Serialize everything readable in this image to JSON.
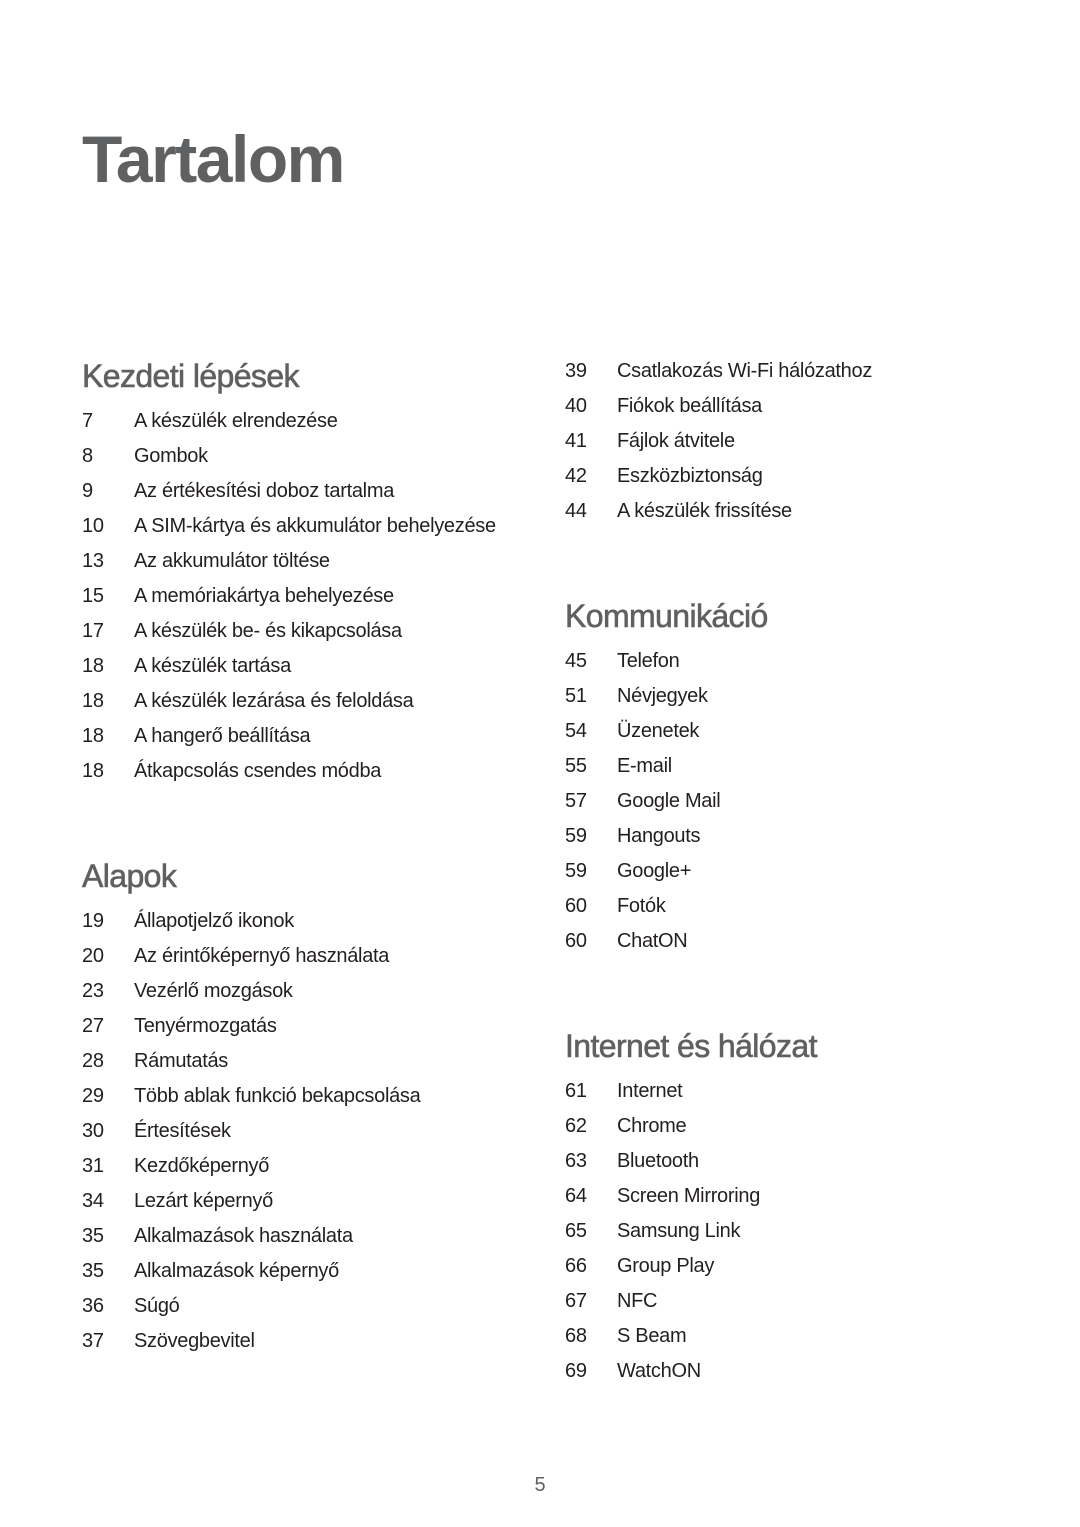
{
  "page": {
    "title": "Tartalom",
    "page_number": "5"
  },
  "sections": {
    "kezdeti": {
      "heading": "Kezdeti lépések",
      "items": [
        {
          "page": "7",
          "label": "A készülék elrendezése"
        },
        {
          "page": "8",
          "label": "Gombok"
        },
        {
          "page": "9",
          "label": "Az értékesítési doboz tartalma"
        },
        {
          "page": "10",
          "label": "A SIM-kártya és akkumulátor behelyezése"
        },
        {
          "page": "13",
          "label": "Az akkumulátor töltése"
        },
        {
          "page": "15",
          "label": "A memóriakártya behelyezése"
        },
        {
          "page": "17",
          "label": "A készülék be- és kikapcsolása"
        },
        {
          "page": "18",
          "label": "A készülék tartása"
        },
        {
          "page": "18",
          "label": "A készülék lezárása és feloldása"
        },
        {
          "page": "18",
          "label": "A hangerő beállítása"
        },
        {
          "page": "18",
          "label": "Átkapcsolás csendes módba"
        }
      ]
    },
    "alapok": {
      "heading": "Alapok",
      "items": [
        {
          "page": "19",
          "label": "Állapotjelző ikonok"
        },
        {
          "page": "20",
          "label": "Az érintőképernyő használata"
        },
        {
          "page": "23",
          "label": "Vezérlő mozgások"
        },
        {
          "page": "27",
          "label": "Tenyérmozgatás"
        },
        {
          "page": "28",
          "label": "Rámutatás"
        },
        {
          "page": "29",
          "label": "Több ablak funkció bekapcsolása"
        },
        {
          "page": "30",
          "label": "Értesítések"
        },
        {
          "page": "31",
          "label": "Kezdőképernyő"
        },
        {
          "page": "34",
          "label": "Lezárt képernyő"
        },
        {
          "page": "35",
          "label": "Alkalmazások használata"
        },
        {
          "page": "35",
          "label": "Alkalmazások képernyő"
        },
        {
          "page": "36",
          "label": "Súgó"
        },
        {
          "page": "37",
          "label": "Szövegbevitel"
        }
      ]
    },
    "alapok_cont": {
      "items": [
        {
          "page": "39",
          "label": "Csatlakozás Wi-Fi hálózathoz"
        },
        {
          "page": "40",
          "label": "Fiókok beállítása"
        },
        {
          "page": "41",
          "label": "Fájlok átvitele"
        },
        {
          "page": "42",
          "label": "Eszközbiztonság"
        },
        {
          "page": "44",
          "label": "A készülék frissítése"
        }
      ]
    },
    "kommunikacio": {
      "heading": "Kommunikáció",
      "items": [
        {
          "page": "45",
          "label": "Telefon"
        },
        {
          "page": "51",
          "label": "Névjegyek"
        },
        {
          "page": "54",
          "label": "Üzenetek"
        },
        {
          "page": "55",
          "label": "E-mail"
        },
        {
          "page": "57",
          "label": "Google Mail"
        },
        {
          "page": "59",
          "label": "Hangouts"
        },
        {
          "page": "59",
          "label": "Google+"
        },
        {
          "page": "60",
          "label": "Fotók"
        },
        {
          "page": "60",
          "label": "ChatON"
        }
      ]
    },
    "internet": {
      "heading": "Internet és hálózat",
      "items": [
        {
          "page": "61",
          "label": "Internet"
        },
        {
          "page": "62",
          "label": "Chrome"
        },
        {
          "page": "63",
          "label": "Bluetooth"
        },
        {
          "page": "64",
          "label": "Screen Mirroring"
        },
        {
          "page": "65",
          "label": "Samsung Link"
        },
        {
          "page": "66",
          "label": "Group Play"
        },
        {
          "page": "67",
          "label": "NFC"
        },
        {
          "page": "68",
          "label": "S Beam"
        },
        {
          "page": "69",
          "label": "WatchON"
        }
      ]
    }
  }
}
